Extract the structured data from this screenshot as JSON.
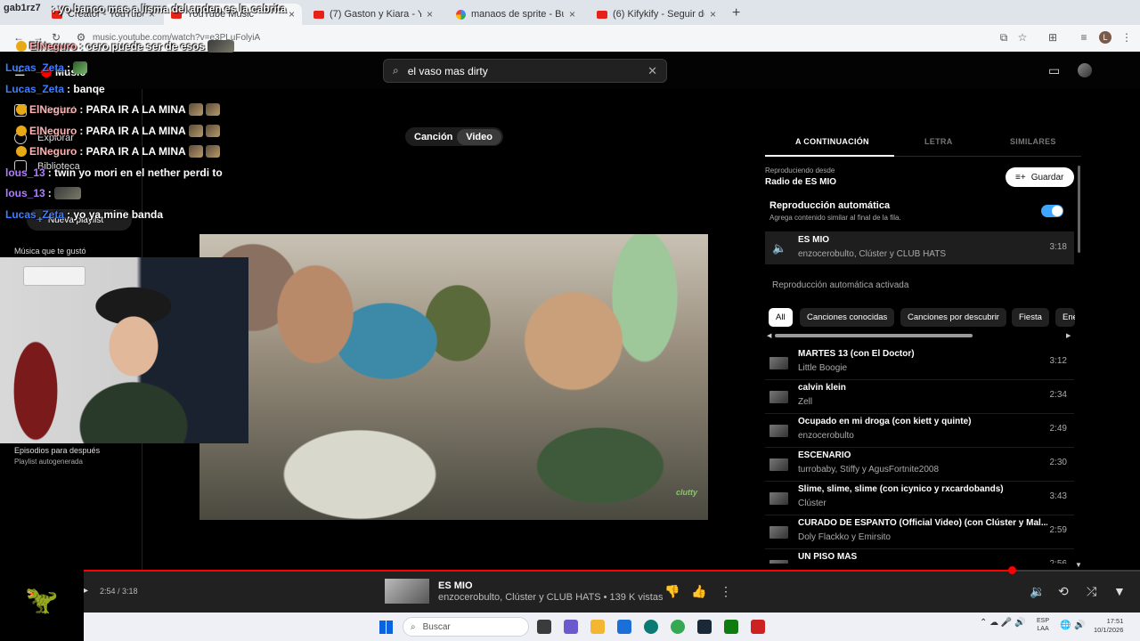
{
  "browser": {
    "tabs": [
      {
        "label": "Creator - YouTube Music",
        "icon": "youtube-icon"
      },
      {
        "label": "YouTube Music",
        "icon": "youtube-music-icon"
      },
      {
        "label": "(7) Gaston y Kiara - YouTube",
        "icon": "youtube-icon"
      },
      {
        "label": "manaos de sprite - Buscar con G",
        "icon": "google-icon"
      },
      {
        "label": "(6) Kifykify - Seguir de largo X d",
        "icon": "youtube-icon"
      }
    ],
    "new_tab": "+",
    "url": "music.youtube.com/watch?v=e3PLuFolyiA",
    "profile_initial": "L"
  },
  "app": {
    "logo_text": "Music",
    "search": {
      "value": "el vaso mas dirty",
      "clear": "✕"
    }
  },
  "sidebar": {
    "items": [
      {
        "label": "Principal",
        "icon": "home-icon"
      },
      {
        "label": "Explorar",
        "icon": "explore-icon"
      },
      {
        "label": "Biblioteca",
        "icon": "library-icon"
      }
    ],
    "new_playlist": "Nueva playlist",
    "liked_title": "Música que te gustó",
    "episodes_title": "Episodios para después",
    "episodes_sub": "Playlist autogenerada"
  },
  "mode_chip": {
    "song": "Canción",
    "video": "Video"
  },
  "chat": {
    "top_user": "gab1rz7",
    "top_message": ": yo banco mas a lisma del anden es la cabrita",
    "messages": [
      {
        "user": "ElNeguro",
        "text": ": cero puede ser de esos",
        "color": "red",
        "badge": true,
        "emote": "wide"
      },
      {
        "user": "Lucas_Zeta",
        "text": ":",
        "color": "blue",
        "emote": "grn"
      },
      {
        "user": "Lucas_Zeta",
        "text": ": banqe",
        "color": "blue"
      },
      {
        "user": "ElNeguro",
        "text": ": PARA IR A LA MINA",
        "color": "red",
        "badge": true,
        "emote": "double"
      },
      {
        "user": "ElNeguro",
        "text": ": PARA IR A LA MINA",
        "color": "red",
        "badge": true,
        "emote": "double"
      },
      {
        "user": "ElNeguro",
        "text": ": PARA IR A LA MINA",
        "color": "red",
        "badge": true,
        "emote": "double"
      },
      {
        "user": "lous_13",
        "text": ": twin yo mori en el nether perdi to",
        "color": "purple"
      },
      {
        "user": "lous_13",
        "text": ":",
        "color": "purple",
        "emote": "wide"
      },
      {
        "user": "Lucas_Zeta",
        "text": ": yo ya mine banda",
        "color": "blue"
      }
    ]
  },
  "video": {
    "caption": "clutty"
  },
  "panel": {
    "tabs": [
      "A CONTINUACIÓN",
      "LETRA",
      "SIMILARES"
    ],
    "playing_from_label": "Reproduciendo desde",
    "playing_from": "Radio de ES MIO",
    "save_label": "Guardar",
    "autoplay_title": "Reproducción automática",
    "autoplay_sub": "Agrega contenido similar al final de la fila.",
    "autoplay_on": true,
    "current": {
      "title": "ES MIO",
      "artist": "enzocerobulto, Clúster y CLUB HATS",
      "duration": "3:18"
    },
    "autoplay_active": "Reproducción automática activada",
    "chips": [
      "All",
      "Canciones conocidas",
      "Canciones por descubrir",
      "Fiesta",
      "Ene"
    ],
    "queue": [
      {
        "title": "MARTES 13 (con El Doctor)",
        "artist": "Little Boogie",
        "duration": "3:12"
      },
      {
        "title": "calvin klein",
        "artist": "Zell",
        "duration": "2:34"
      },
      {
        "title": "Ocupado en mi droga (con kiett y quinte)",
        "artist": "enzocerobulto",
        "duration": "2:49"
      },
      {
        "title": "ESCENARIO",
        "artist": "turrobaby, Stiffy y AgusFortnite2008",
        "duration": "2:30"
      },
      {
        "title": "Slime, slime, slime (con icynico y rxcardobands)",
        "artist": "Clúster",
        "duration": "3:43"
      },
      {
        "title": "CURADO DE ESPANTO (Official Video) (con Clúster y Mal...",
        "artist": "Doly Flackko y Emirsito",
        "duration": "2:59"
      },
      {
        "title": "UN PISO MÁS",
        "artist": "",
        "duration": "2:56"
      }
    ]
  },
  "player": {
    "time": "2:54 / 3:18",
    "progress": 0.8788,
    "title": "ES MIO",
    "meta": "enzocerobulto, Clúster y CLUB HATS • 139 K vistas"
  },
  "taskbar": {
    "search_placeholder": "Buscar",
    "lang_1": "ESP",
    "lang_2": "LAA",
    "time": "17:51",
    "date": "10/1/2026",
    "app_colors": [
      "#3b3b3b",
      "#6a5acd",
      "#f2b632",
      "#1a6fd8",
      "#0b7a75",
      "#34a853",
      "#1b2838",
      "#107c10",
      "#cc2222"
    ]
  }
}
